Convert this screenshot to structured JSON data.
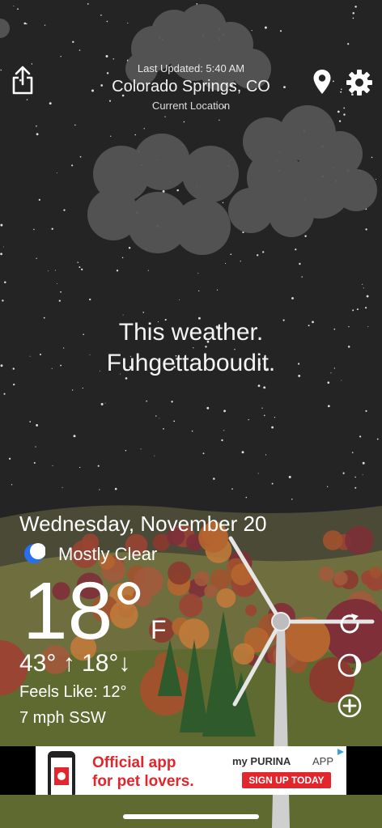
{
  "header": {
    "last_updated": "Last Updated: 5:40 AM",
    "location": "Colorado Springs, CO",
    "location_sub": "Current Location",
    "icons": {
      "share": "share-icon",
      "pin": "location-pin-icon",
      "settings": "gear-icon"
    }
  },
  "tagline": {
    "line1": "This weather.",
    "line2": "Fuhgettaboudit."
  },
  "conditions": {
    "date": "Wednesday, November 20",
    "summary": "Mostly Clear",
    "summary_icon": "moon-icon",
    "temperature": "18°",
    "unit": "F",
    "hilo": "43° ↑  18°↓",
    "feels_like": "Feels Like: 12°",
    "wind": "7 mph SSW"
  },
  "actions": {
    "icons": [
      "refresh-icon",
      "moon-phase-icon",
      "add-icon"
    ]
  },
  "ad": {
    "line1": "Official app",
    "line2": "for pet lovers.",
    "brand": "my PURINA",
    "brand_suffix": "APP",
    "cta": "SIGN UP TODAY"
  },
  "colors": {
    "sky": "#242424",
    "hill": "#6f6e3e",
    "ad_red": "#e1262d",
    "moon": "#2a6ef0"
  }
}
